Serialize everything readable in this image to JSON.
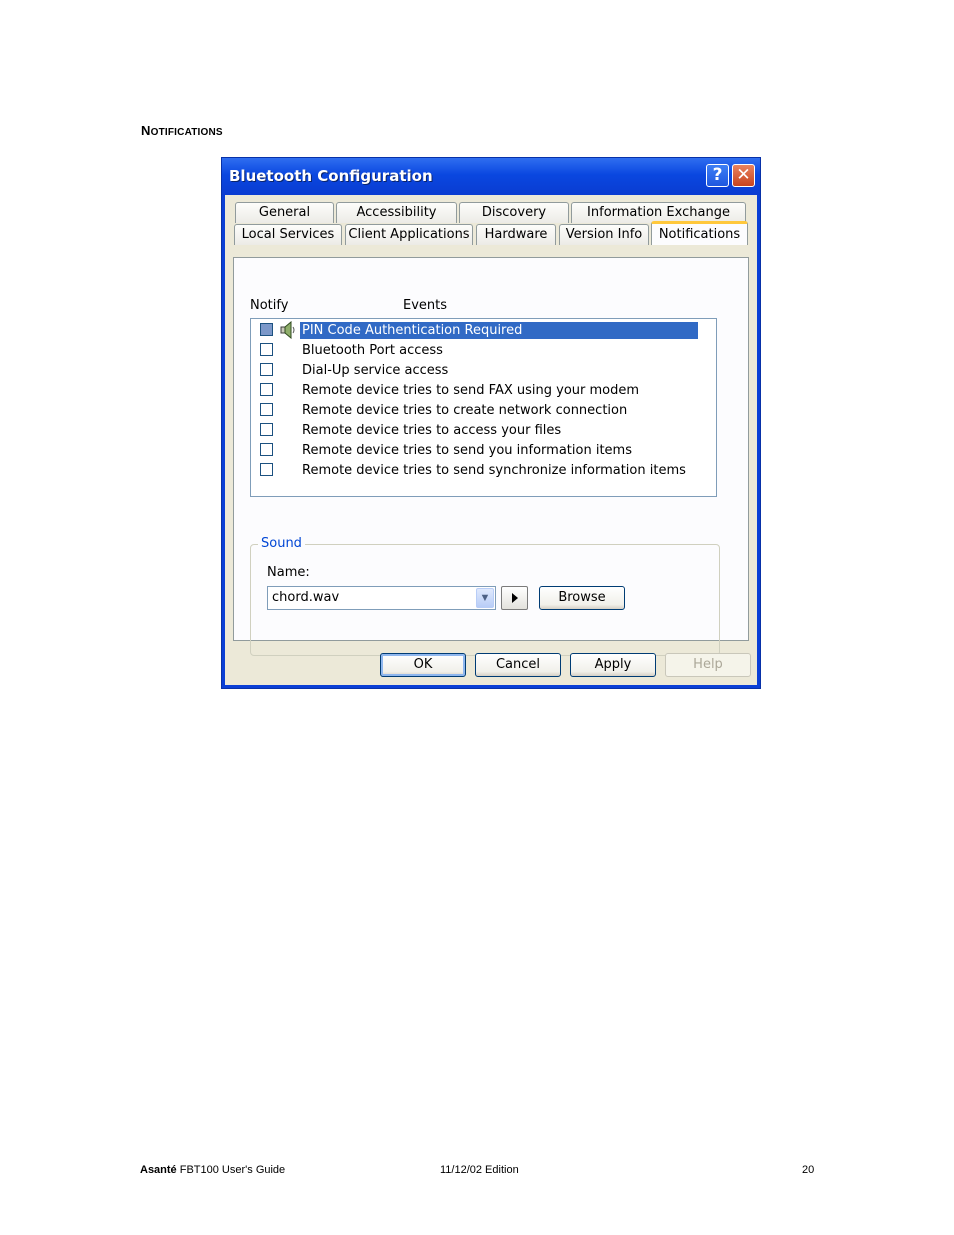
{
  "page": {
    "heading_first": "N",
    "heading_rest": "otifications",
    "footer": {
      "brand": "Asanté",
      "guide": "FBT100 User's Guide",
      "edition": "11/12/02 Edition",
      "page_number": "20"
    }
  },
  "dialog": {
    "title": "Bluetooth Configuration",
    "help_glyph": "?",
    "close_glyph": "✕",
    "tabs_row1": [
      "General",
      "Accessibility",
      "Discovery",
      "Information Exchange"
    ],
    "tabs_row2": [
      "Local Services",
      "Client Applications",
      "Hardware",
      "Version Info",
      "Notifications"
    ],
    "active_tab": "Notifications",
    "columns": {
      "notify": "Notify",
      "events": "Events"
    },
    "events": [
      {
        "label": "PIN Code Authentication Required",
        "checked": false,
        "selected": true,
        "sound_icon": "speaker-icon"
      },
      {
        "label": "Bluetooth Port access",
        "checked": false,
        "selected": false
      },
      {
        "label": "Dial-Up service access",
        "checked": false,
        "selected": false
      },
      {
        "label": "Remote device tries to send FAX using your modem",
        "checked": false,
        "selected": false
      },
      {
        "label": "Remote device tries to create network connection",
        "checked": false,
        "selected": false
      },
      {
        "label": "Remote device tries to access your files",
        "checked": false,
        "selected": false
      },
      {
        "label": "Remote device tries to send you information items",
        "checked": false,
        "selected": false
      },
      {
        "label": "Remote device tries to send synchronize information items",
        "checked": false,
        "selected": false
      }
    ],
    "sound": {
      "group_label": "Sound",
      "name_label": "Name:",
      "name_value": "chord.wav",
      "browse_label": "Browse"
    },
    "buttons": {
      "ok": "OK",
      "cancel": "Cancel",
      "apply": "Apply",
      "help": "Help"
    },
    "colors": {
      "titlebar": "#0a47e0",
      "selection": "#316ac5",
      "face": "#ece9d8",
      "active_tab_accent": "#ffc83c"
    }
  }
}
